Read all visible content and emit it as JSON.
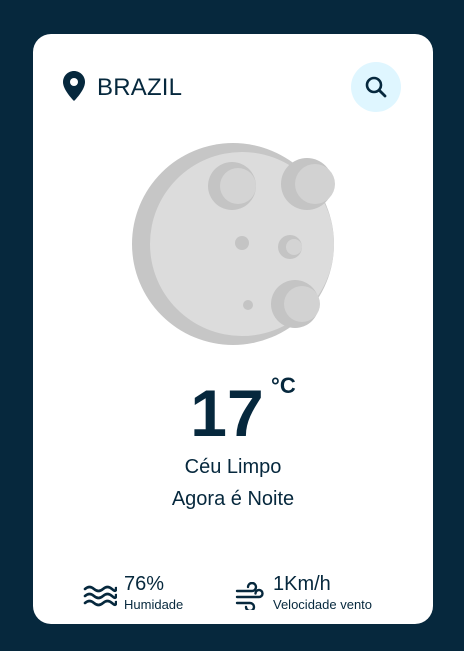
{
  "location": {
    "icon": "map-pin-icon",
    "name": "BRAZIL"
  },
  "search": {
    "icon": "search-icon"
  },
  "weather": {
    "image": "moon-icon",
    "temperature": "17",
    "unit": "°C",
    "description": "Céu Limpo",
    "period": "Agora é Noite"
  },
  "details": {
    "humidity": {
      "icon": "water-waves-icon",
      "value": "76%",
      "label": "Humidade"
    },
    "wind": {
      "icon": "wind-icon",
      "value": "1Km/h",
      "label": "Velocidade vento"
    }
  },
  "colors": {
    "background": "#06283d",
    "card": "#ffffff",
    "text": "#06283d",
    "search_button_bg": "#dff6ff",
    "moon_light": "#dcdcdc",
    "moon_shadow": "#c4c4c4",
    "crater": "#bdbdbd"
  }
}
